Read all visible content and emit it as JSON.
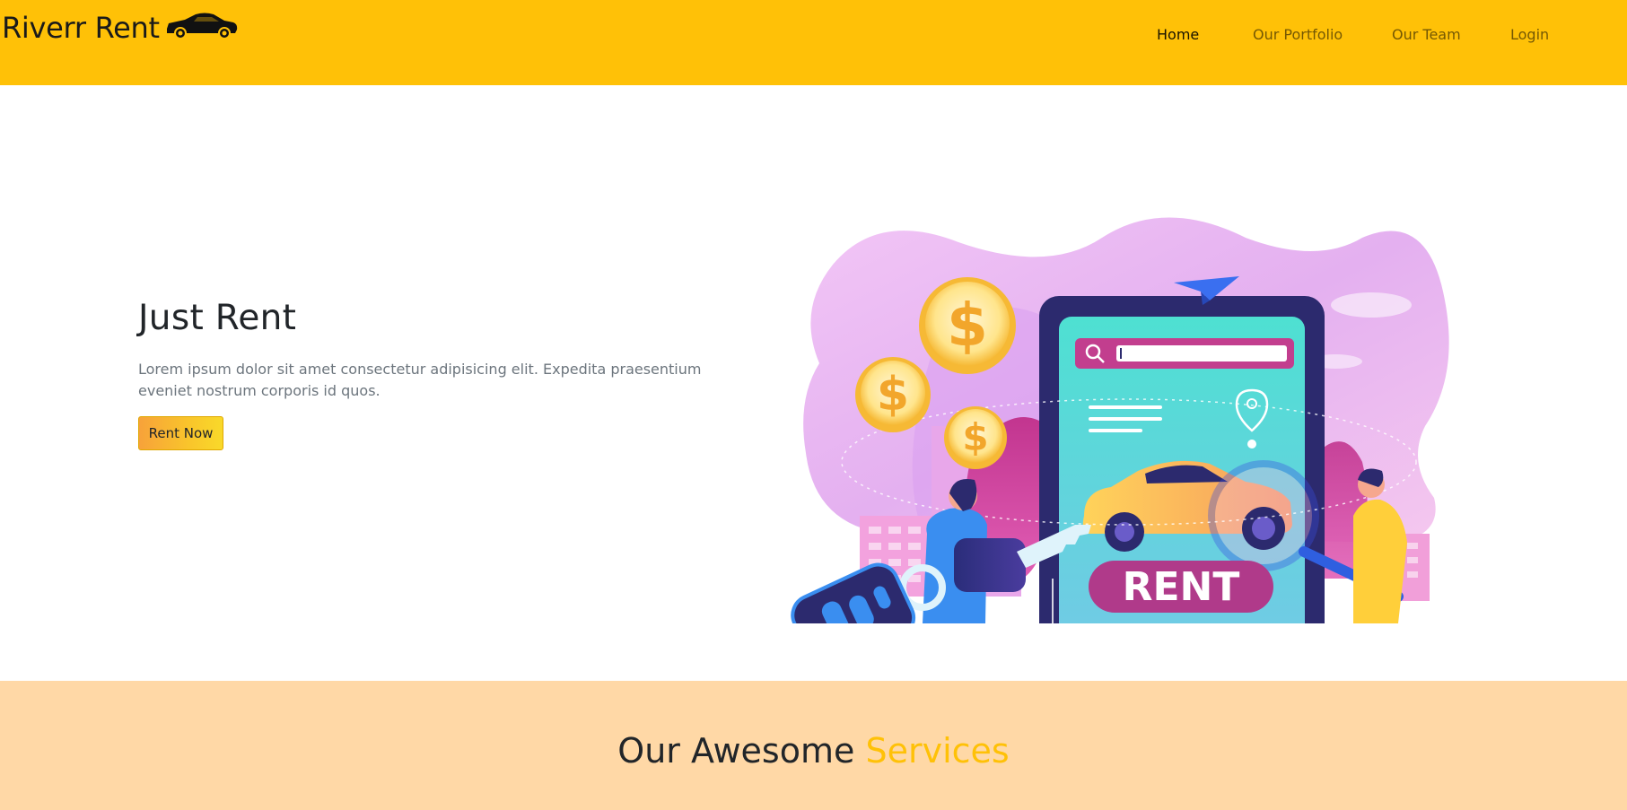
{
  "header": {
    "brand": "Riverr Rent",
    "brand_icon": "car-silhouette-icon",
    "nav": [
      {
        "label": "Home",
        "active": true
      },
      {
        "label": "Our Portfolio",
        "active": false
      },
      {
        "label": "Our Team",
        "active": false
      },
      {
        "label": "Login",
        "active": false
      }
    ]
  },
  "hero": {
    "title": "Just Rent",
    "text": "Lorem ipsum dolor sit amet consectetur adipisicing elit. Expedita praesentium eveniet nostrum corporis id quos.",
    "button_label": "Rent Now",
    "illustration": {
      "sign_text": "RENT",
      "coin_symbol": "$"
    }
  },
  "services": {
    "title_prefix": "Our Awesome",
    "title_accent": "Services"
  },
  "colors": {
    "primary": "#ffc107",
    "services_bg": "#ffd8a6",
    "muted_text": "#6c757d"
  }
}
